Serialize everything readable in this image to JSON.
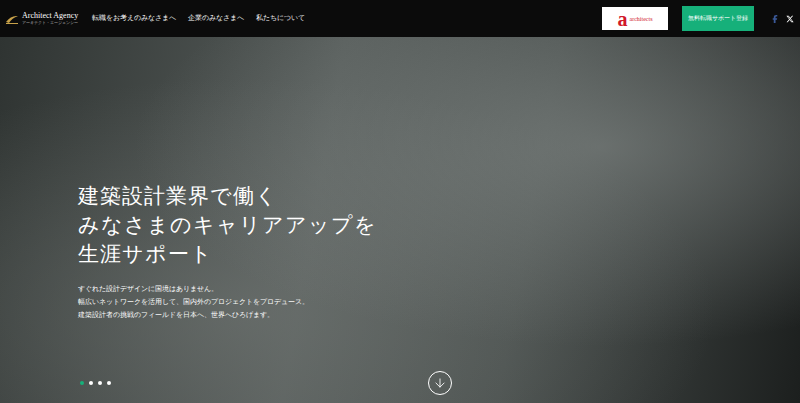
{
  "header": {
    "logo": {
      "name": "Architect Agency",
      "sub": "アーキテクト・エージェンシー"
    },
    "nav": [
      "転職をお考えのみなさまへ",
      "企業のみなさまへ",
      "私たちについて"
    ],
    "partner_logo": {
      "mark": "a",
      "name": "architects"
    },
    "cta": "無料転職サポート登録"
  },
  "hero": {
    "heading": [
      "建築設計業界で働く",
      "みなさまのキャリアアップを",
      "生涯サポート"
    ],
    "lead": [
      "すぐれた設計デザインに国境はありません。",
      "幅広いネットワークを活用して、国内外のプロジェクトをプロデュース。",
      "建築設計者の挑戦のフィールドを日本へ、世界へひろげます。"
    ]
  },
  "carousel": {
    "slides": [
      {
        "selected": true
      },
      {
        "selected": false
      },
      {
        "selected": false
      },
      {
        "selected": false
      }
    ]
  }
}
